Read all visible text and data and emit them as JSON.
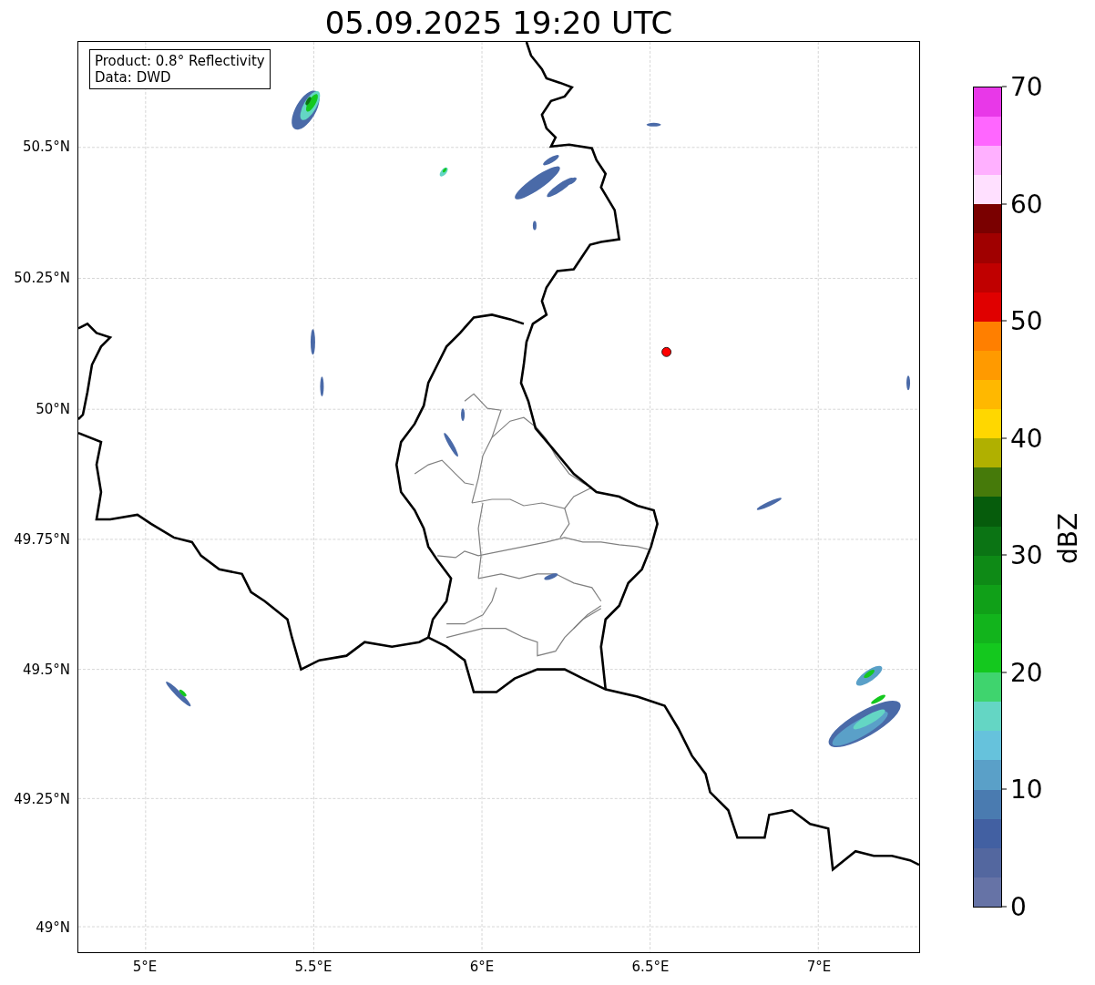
{
  "title": "05.09.2025 19:20 UTC",
  "info_box": {
    "lines": [
      "Product: 0.8° Reflectivity",
      "Data: DWD"
    ]
  },
  "map": {
    "yticks": [
      "50.5°N",
      "50.25°N",
      "50°N",
      "49.75°N",
      "49.5°N",
      "49.25°N",
      "49°N"
    ],
    "xticks": [
      "5°E",
      "5.5°E",
      "6°E",
      "6.5°E",
      "7°E"
    ]
  },
  "colorbar": {
    "label": "dBZ",
    "ticks": [
      "70",
      "60",
      "50",
      "40",
      "30",
      "20",
      "10",
      "0"
    ],
    "segments": [
      {
        "color": "#6673a6"
      },
      {
        "color": "#53679f"
      },
      {
        "color": "#4260a2"
      },
      {
        "color": "#4a7bb0"
      },
      {
        "color": "#5aa0c8"
      },
      {
        "color": "#66c2dc"
      },
      {
        "color": "#64d6c4"
      },
      {
        "color": "#3fd46e"
      },
      {
        "color": "#14c81e"
      },
      {
        "color": "#12b41c"
      },
      {
        "color": "#10a018"
      },
      {
        "color": "#0e8a16"
      },
      {
        "color": "#0b7414"
      },
      {
        "color": "#065c0c"
      },
      {
        "color": "#467a0a"
      },
      {
        "color": "#b0b000"
      },
      {
        "color": "#ffd700"
      },
      {
        "color": "#ffb800"
      },
      {
        "color": "#ff9a00"
      },
      {
        "color": "#ff7f00"
      },
      {
        "color": "#e00000"
      },
      {
        "color": "#c00000"
      },
      {
        "color": "#a00000"
      },
      {
        "color": "#7a0000"
      },
      {
        "color": "#ffe0ff"
      },
      {
        "color": "#ffb0ff"
      },
      {
        "color": "#ff66ff"
      },
      {
        "color": "#e838e8"
      }
    ]
  }
}
